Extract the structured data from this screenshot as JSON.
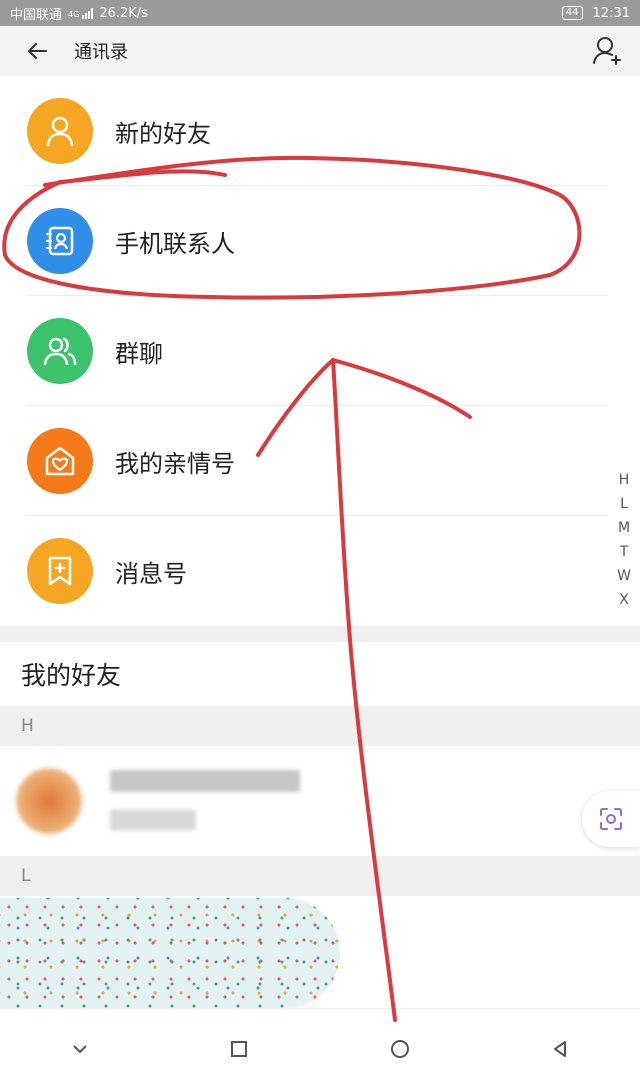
{
  "status_bar": {
    "carrier": "中国联通",
    "signal_label": "4G",
    "speed": "26.2K/s",
    "battery": "44",
    "time": "12:31"
  },
  "header": {
    "title": "通讯录",
    "back_icon": "arrow-left-icon",
    "add_icon": "add-contact-icon"
  },
  "menu": {
    "items": [
      {
        "label": "新的好友",
        "icon": "person-icon",
        "color": "#f5a623"
      },
      {
        "label": "手机联系人",
        "icon": "phone-contacts-icon",
        "color": "#2f8fe8"
      },
      {
        "label": "群聊",
        "icon": "group-icon",
        "color": "#3cc26a"
      },
      {
        "label": "我的亲情号",
        "icon": "family-home-icon",
        "color": "#f47a1a"
      },
      {
        "label": "消息号",
        "icon": "bookmark-plus-icon",
        "color": "#f5a623"
      }
    ]
  },
  "friends": {
    "heading": "我的好友",
    "sections": [
      {
        "letter": "H"
      },
      {
        "letter": "L"
      }
    ]
  },
  "index_letters": [
    "H",
    "L",
    "M",
    "T",
    "W",
    "X"
  ],
  "colors": {
    "annotation_red": "#d93a3f",
    "scan_icon": "#8a6fd0"
  }
}
